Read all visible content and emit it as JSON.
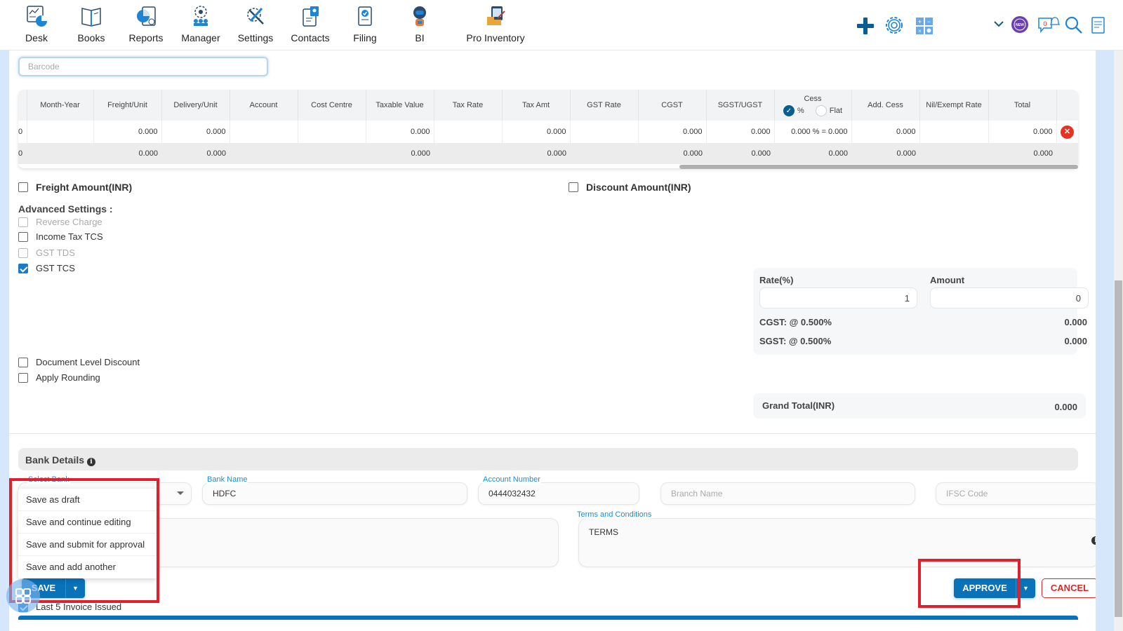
{
  "topnav": {
    "items": [
      {
        "label": "Desk",
        "icon": "desk-icon"
      },
      {
        "label": "Books",
        "icon": "books-icon"
      },
      {
        "label": "Reports",
        "icon": "reports-icon"
      },
      {
        "label": "Manager",
        "icon": "manager-icon"
      },
      {
        "label": "Settings",
        "icon": "settings-tools-icon"
      },
      {
        "label": "Contacts",
        "icon": "contacts-icon"
      },
      {
        "label": "Filing",
        "icon": "filing-icon"
      },
      {
        "label": "BI",
        "icon": "bi-robot-icon"
      },
      {
        "label": "Pro Inventory",
        "icon": "pro-inventory-icon"
      }
    ],
    "right_icons": [
      "plus-icon",
      "gear-icon",
      "calculator-icon",
      "chevron-down-icon",
      "new-badge-icon",
      "notification-icon",
      "search-icon",
      "clipboard-icon"
    ],
    "notification_count": "0",
    "new_badge": "NEW"
  },
  "barcode": {
    "placeholder": "Barcode"
  },
  "table": {
    "columns": [
      "Month-Year",
      "Freight/Unit",
      "Delivery/Unit",
      "Account",
      "Cost Centre",
      "Taxable Value",
      "Tax Rate",
      "Tax Amt",
      "GST Rate",
      "CGST",
      "SGST/UGST",
      "Cess",
      "Add. Cess",
      "Nil/Exempt Rate",
      "Total"
    ],
    "cess_options": {
      "percent": "%",
      "flat": "Flat",
      "selected": "percent"
    },
    "rows": [
      {
        "lead": "0",
        "month_year": "",
        "freight_unit": "0.000",
        "delivery_unit": "0.000",
        "account": "",
        "cost_centre": "",
        "taxable_value": "0.000",
        "tax_rate": "",
        "tax_amt": "0.000",
        "gst_rate": "",
        "cgst": "0.000",
        "sgst": "0.000",
        "cess": "0.000 % = 0.000",
        "add_cess": "0.000",
        "nil_exempt": "",
        "total": "0.000"
      }
    ],
    "totals": {
      "lead": "0",
      "freight_unit": "0.000",
      "delivery_unit": "0.000",
      "taxable_value": "0.000",
      "tax_amt": "0.000",
      "cgst": "0.000",
      "sgst": "0.000",
      "cess": "0.000",
      "add_cess": "0.000",
      "total": "0.000"
    }
  },
  "options": {
    "freight_amount": {
      "label": "Freight Amount(INR)",
      "checked": false
    },
    "discount_amount": {
      "label": "Discount Amount(INR)",
      "checked": false
    },
    "advanced_title": "Advanced Settings :",
    "advanced": [
      {
        "label": "Reverse Charge",
        "checked": false,
        "disabled": true
      },
      {
        "label": "Income Tax TCS",
        "checked": false,
        "disabled": false
      },
      {
        "label": "GST TDS",
        "checked": false,
        "disabled": true
      },
      {
        "label": "GST TCS",
        "checked": true,
        "disabled": false
      }
    ],
    "document_level_discount": {
      "label": "Document Level Discount",
      "checked": false
    },
    "apply_rounding": {
      "label": "Apply Rounding",
      "checked": false
    }
  },
  "tcs": {
    "rate_label": "Rate(%)",
    "rate_value": "1",
    "amount_label": "Amount",
    "amount_value": "0",
    "cgst_label": "CGST: @ 0.500%",
    "cgst_value": "0.000",
    "sgst_label": "SGST: @ 0.500%",
    "sgst_value": "0.000"
  },
  "grand_total": {
    "label": "Grand Total(INR)",
    "value": "0.000"
  },
  "bank": {
    "title": "Bank Details",
    "select_bank_label": "Select Bank",
    "bank_name_label": "Bank Name",
    "bank_name": "HDFC",
    "account_number_label": "Account Number",
    "account_number": "0444032432",
    "branch_placeholder": "Branch Name",
    "ifsc_placeholder": "IFSC Code",
    "terms_label": "Terms and Conditions",
    "terms_value": "TERMS"
  },
  "save_menu": {
    "items": [
      "Save as draft",
      "Save and continue editing",
      "Save and submit for approval",
      "Save and add another"
    ]
  },
  "actions": {
    "save": "SAVE",
    "approve": "APPROVE",
    "cancel": "CANCEL"
  },
  "last_invoice": {
    "label": "Last 5 Invoice Issued",
    "checked": true
  }
}
